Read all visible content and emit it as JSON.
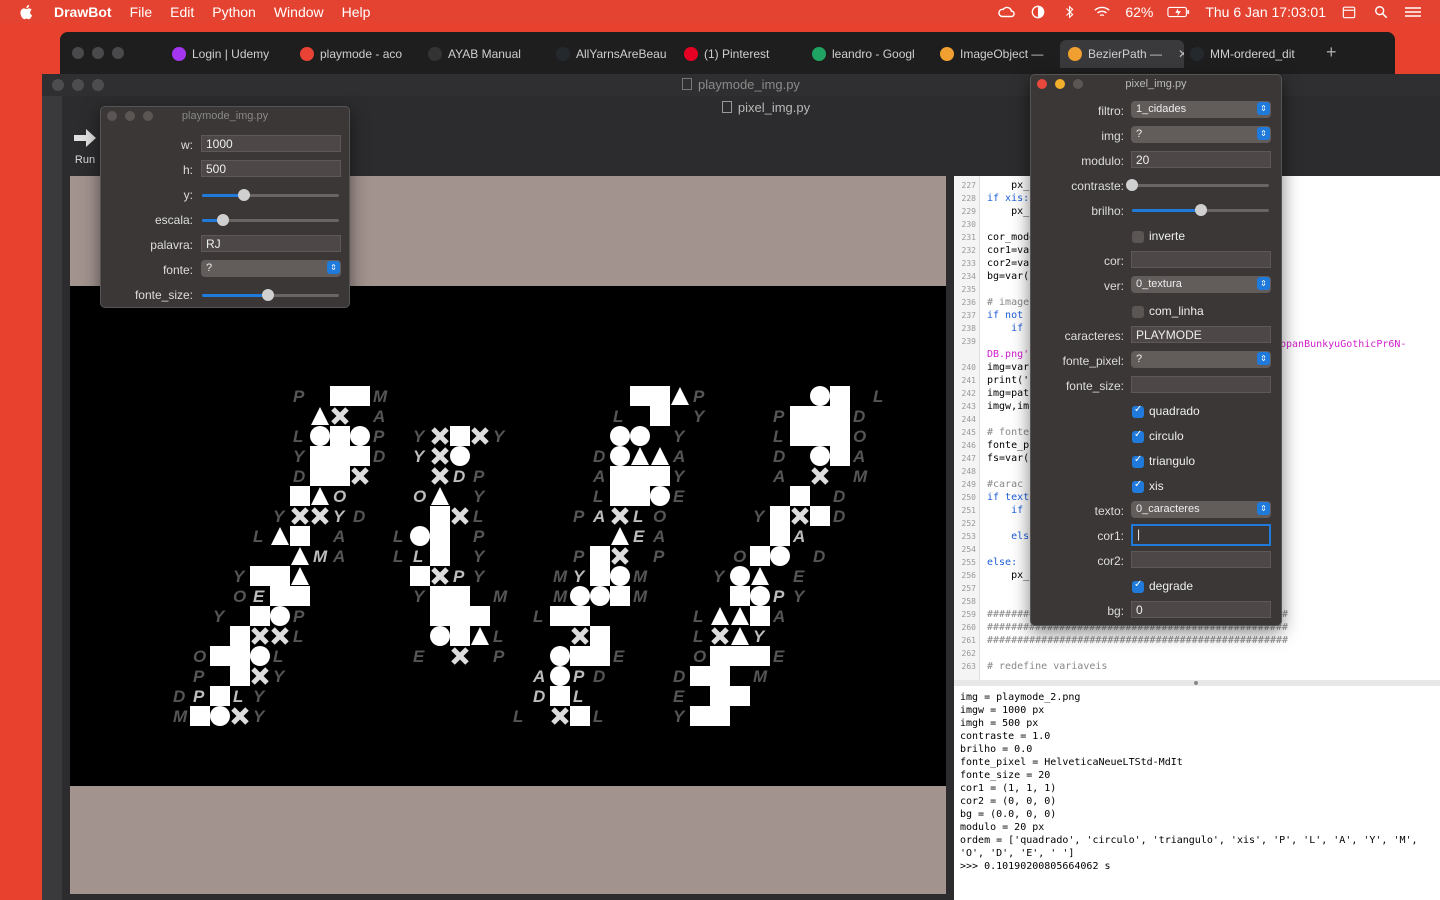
{
  "menubar": {
    "app": "DrawBot",
    "items": [
      "File",
      "Edit",
      "Python",
      "Window",
      "Help"
    ],
    "battery": "62%",
    "clock": "Thu 6 Jan  17:03:01"
  },
  "browser_tabs": [
    {
      "label": "Login | Udemy",
      "color": "#a435f0"
    },
    {
      "label": "playmode - aco",
      "color": "#ea4335"
    },
    {
      "label": "AYAB Manual",
      "color": "#333333"
    },
    {
      "label": "AllYarnsAreBeau",
      "color": "#24292e"
    },
    {
      "label": "(1) Pinterest",
      "color": "#e60023"
    },
    {
      "label": "leandro - Googl",
      "color": "#1fa463"
    },
    {
      "label": "ImageObject —",
      "color": "#f0a030"
    },
    {
      "label": "BezierPath —",
      "color": "#f0a030"
    },
    {
      "label": "MM-ordered_dit",
      "color": "#24292e"
    }
  ],
  "windows": {
    "main_title": "playmode_img.py",
    "pixel_title": "pixel_img.py",
    "run_label": "Run"
  },
  "left_panel": {
    "title": "playmode_img.py",
    "w_label": "w:",
    "w_value": "1000",
    "h_label": "h:",
    "h_value": "500",
    "y_label": "y:",
    "y_value": 0.31,
    "escala_label": "escala:",
    "escala_value": 0.15,
    "palavra_label": "palavra:",
    "palavra_value": "RJ",
    "fonte_label": "fonte:",
    "fonte_value": "?",
    "fonte_size_label": "fonte_size:",
    "fonte_size_value": 0.48
  },
  "right_panel": {
    "title": "pixel_img.py",
    "filtro_label": "filtro:",
    "filtro_value": "1_cidades",
    "img_label": "img:",
    "img_value": "?",
    "modulo_label": "modulo:",
    "modulo_value": "20",
    "contraste_label": "contraste:",
    "contraste_value": 0.0,
    "brilho_label": "brilho:",
    "brilho_value": 0.5,
    "inverte_label": "inverte",
    "inverte_checked": false,
    "cor_label": "cor:",
    "cor_value": "",
    "ver_label": "ver:",
    "ver_value": "0_textura",
    "com_linha_label": "com_linha",
    "com_linha_checked": false,
    "caracteres_label": "caracteres:",
    "caracteres_value": "PLAYMODE",
    "fonte_pixel_label": "fonte_pixel:",
    "fonte_pixel_value": "?",
    "fonte_size_label": "fonte_size:",
    "fonte_size_value": "",
    "quadrado_label": "quadrado",
    "circulo_label": "circulo",
    "triangulo_label": "triangulo",
    "xis_label": "xis",
    "texto_label": "texto:",
    "texto_value": "0_caracteres",
    "cor1_label": "cor1:",
    "cor1_value": "|",
    "cor2_label": "cor2:",
    "cor2_value": "",
    "degrade_label": "degrade",
    "bg_label": "bg:",
    "bg_value": "0"
  },
  "code_lines": [
    {
      "n": "227",
      "t": "    px_"
    },
    {
      "n": "228",
      "t": "if xis:"
    },
    {
      "n": "229",
      "t": "    px_"
    },
    {
      "n": "230",
      "t": ""
    },
    {
      "n": "231",
      "t": "cor_mode"
    },
    {
      "n": "232",
      "t": "cor1=va"
    },
    {
      "n": "233",
      "t": "cor2=va"
    },
    {
      "n": "234",
      "t": "bg=var("
    },
    {
      "n": "235",
      "t": ""
    },
    {
      "n": "236",
      "t": "# image"
    },
    {
      "n": "237",
      "t": "if not"
    },
    {
      "n": "238",
      "t": "    if"
    },
    {
      "n": "239",
      "t": ""
    },
    {
      "n": "",
      "t": "DB.png'"
    },
    {
      "n": "240",
      "t": "img=var"
    },
    {
      "n": "241",
      "t": "print('"
    },
    {
      "n": "242",
      "t": "img=pat"
    },
    {
      "n": "243",
      "t": "imgw,im"
    },
    {
      "n": "244",
      "t": ""
    },
    {
      "n": "245",
      "t": "# fonte"
    },
    {
      "n": "246",
      "t": "fonte_p"
    },
    {
      "n": "247",
      "t": "fs=var("
    },
    {
      "n": "248",
      "t": ""
    },
    {
      "n": "249",
      "t": "#carac"
    },
    {
      "n": "250",
      "t": "if text"
    },
    {
      "n": "251",
      "t": "    if"
    },
    {
      "n": "252",
      "t": ""
    },
    {
      "n": "253",
      "t": "    els"
    },
    {
      "n": "254",
      "t": ""
    },
    {
      "n": "255",
      "t": "else:"
    },
    {
      "n": "256",
      "t": "    px_"
    },
    {
      "n": "257",
      "t": ""
    },
    {
      "n": "258",
      "t": ""
    },
    {
      "n": "259",
      "t": "##################################################"
    },
    {
      "n": "260",
      "t": "##################################################"
    },
    {
      "n": "261",
      "t": "##################################################"
    },
    {
      "n": "262",
      "t": ""
    },
    {
      "n": "263",
      "t": "# redefine variaveis"
    }
  ],
  "code_overflow": "ppanBunkyuGothicPr6N-",
  "output": "img = playmode_2.png\nimgw = 1000 px\nimgh = 500 px\ncontraste = 1.0\nbrilho = 0.0\nfonte_pixel = HelveticaNeueLTStd-MdIt\nfonte_size = 20\ncor1 = (1, 1, 1)\ncor2 = (0, 0, 0)\nbg = (0.0, 0, 0)\nmodulo = 20 px\nordem = ['quadrado', 'circulo', 'triangulo', 'xis', 'P', 'L', 'A', 'Y', 'M',\n'O', 'D', 'E', ' ']\n>>> 0.10190200805664062 s",
  "canvas": {
    "chars": "PLAYMODE"
  }
}
